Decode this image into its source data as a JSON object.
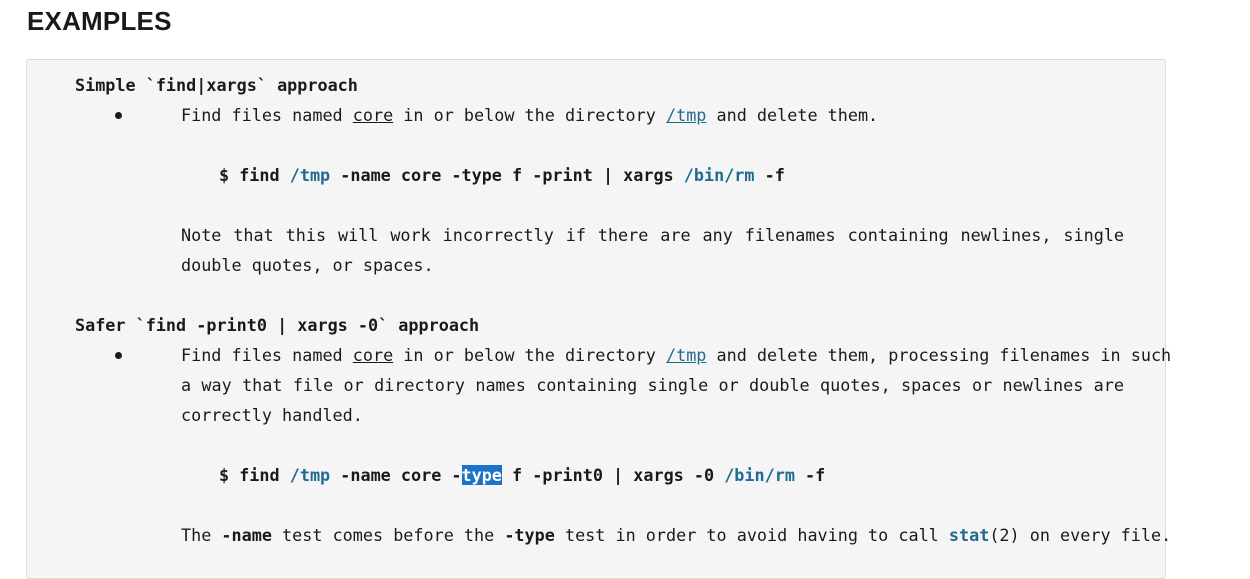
{
  "section": {
    "title": "EXAMPLES"
  },
  "example1": {
    "heading": "Simple `find|xargs` approach",
    "desc": {
      "pre": "Find files named ",
      "name": "core",
      "mid": " in or below the directory ",
      "dir": "/tmp",
      "post": " and delete them."
    },
    "cmd": {
      "prompt": "$ find ",
      "dir": "/tmp",
      "opt_name": " -name core -type f -print | xargs ",
      "rm": "/bin/rm",
      "flag": " -f"
    },
    "note_line1": "Note that this will work incorrectly if there are any filenames containing newlines, single or",
    "note_line2": "double quotes, or spaces."
  },
  "example2": {
    "heading": "Safer `find -print0 | xargs -0` approach",
    "desc": {
      "pre": "Find files named ",
      "name": "core",
      "mid": " in or below the directory ",
      "dir": "/tmp",
      "post": " and delete them, processing filenames in such",
      "line2": "a way that file or directory names containing single or double quotes, spaces or newlines are",
      "line3": "correctly handled."
    },
    "cmd": {
      "prompt": "$ find ",
      "dir": "/tmp",
      "pre_sel": " -name core -",
      "sel": "type",
      "post_sel": " f -print0 | xargs -0 ",
      "rm": "/bin/rm",
      "flag": " -f"
    },
    "note": {
      "t1": "The ",
      "opt1": "-name",
      "t2": " test comes before the ",
      "opt2": "-type",
      "t3": " test in order to avoid having to call ",
      "fn": "stat",
      "t4": "(2) on every file."
    }
  }
}
